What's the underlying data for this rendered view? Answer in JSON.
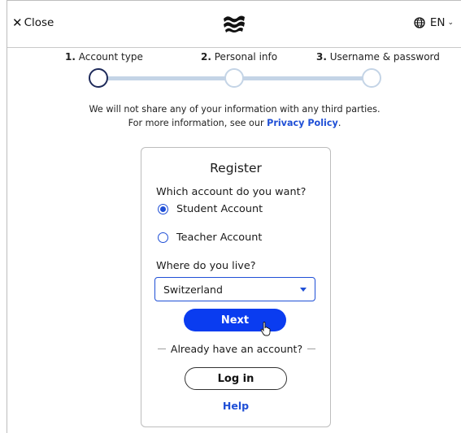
{
  "header": {
    "close_label": "Close",
    "lang_label": "EN",
    "icons": {
      "close": "close-icon",
      "logo": "brand-logo",
      "globe": "globe-icon",
      "chevron": "chevron-down-icon"
    }
  },
  "stepper": {
    "steps": [
      {
        "number": "1.",
        "label": "Account type",
        "active": true
      },
      {
        "number": "2.",
        "label": "Personal info",
        "active": false
      },
      {
        "number": "3.",
        "label": "Username & password",
        "active": false
      }
    ]
  },
  "notice": {
    "line1": "We will not share any of your information with any third parties.",
    "line2_prefix": "For more information, see our",
    "privacy_link": "Privacy Policy",
    "line2_suffix": "."
  },
  "form": {
    "title": "Register",
    "account_question": "Which account do you want?",
    "options": [
      {
        "label": "Student Account",
        "selected": true
      },
      {
        "label": "Teacher Account",
        "selected": false
      }
    ],
    "location_question": "Where do you live?",
    "country_value": "Switzerland",
    "next_label": "Next",
    "divider_text": "Already have an account?",
    "login_label": "Log in",
    "help_label": "Help"
  },
  "colors": {
    "accent": "#1f4fd6",
    "primary_button": "#0a3cf0",
    "track": "#c4d4e6",
    "active_node": "#1e2a5a"
  }
}
